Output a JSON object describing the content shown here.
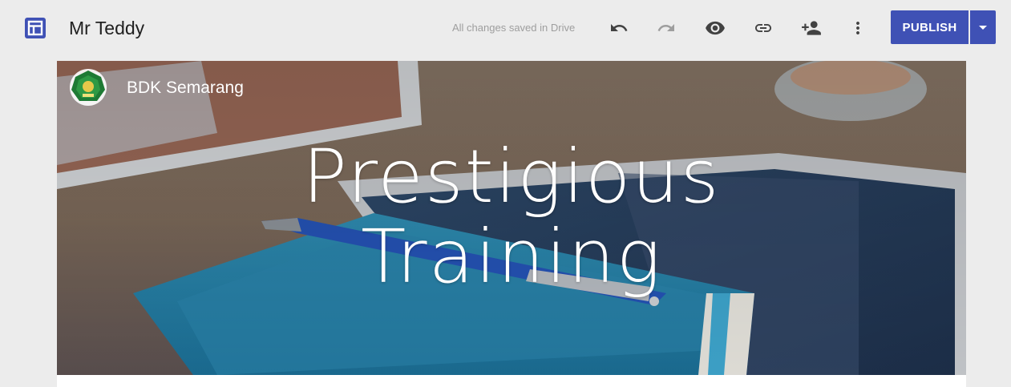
{
  "header": {
    "doc_title": "Mr Teddy",
    "save_status": "All changes saved in Drive",
    "publish_label": "PUBLISH",
    "icons": [
      "undo-icon",
      "redo-icon",
      "preview-icon",
      "link-icon",
      "add-person-icon",
      "more-vert-icon",
      "dropdown-arrow-icon"
    ],
    "accent_color": "#3f51b5"
  },
  "site": {
    "name": "BDK Semarang",
    "hero_title_line1": "Prestigious",
    "hero_title_line2": "Training"
  }
}
